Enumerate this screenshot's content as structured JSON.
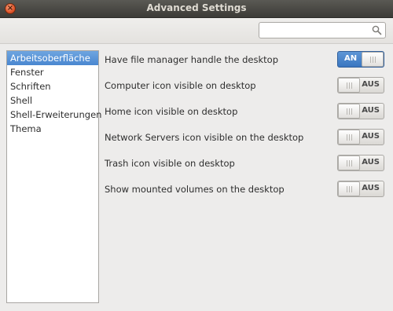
{
  "window": {
    "title": "Advanced Settings",
    "close_glyph": "×"
  },
  "toolbar": {
    "search_value": "",
    "search_placeholder": ""
  },
  "sidebar": {
    "items": [
      {
        "label": "Arbeitsoberfläche",
        "selected": true
      },
      {
        "label": "Fenster",
        "selected": false
      },
      {
        "label": "Schriften",
        "selected": false
      },
      {
        "label": "Shell",
        "selected": false
      },
      {
        "label": "Shell-Erweiterungen",
        "selected": false
      },
      {
        "label": "Thema",
        "selected": false
      }
    ]
  },
  "settings": [
    {
      "label": "Have file manager handle the desktop",
      "state": "AN",
      "on": true
    },
    {
      "label": "Computer icon visible on desktop",
      "state": "AUS",
      "on": false
    },
    {
      "label": "Home icon visible on desktop",
      "state": "AUS",
      "on": false
    },
    {
      "label": "Network Servers icon visible on the desktop",
      "state": "AUS",
      "on": false
    },
    {
      "label": "Trash icon visible on desktop",
      "state": "AUS",
      "on": false
    },
    {
      "label": "Show mounted volumes on the desktop",
      "state": "AUS",
      "on": false
    }
  ],
  "colors": {
    "accent": "#4a87d0",
    "titlebar": "#3c3b37",
    "window_bg": "#edeceb"
  },
  "icons": {
    "close": "close-icon",
    "search": "search-icon"
  }
}
